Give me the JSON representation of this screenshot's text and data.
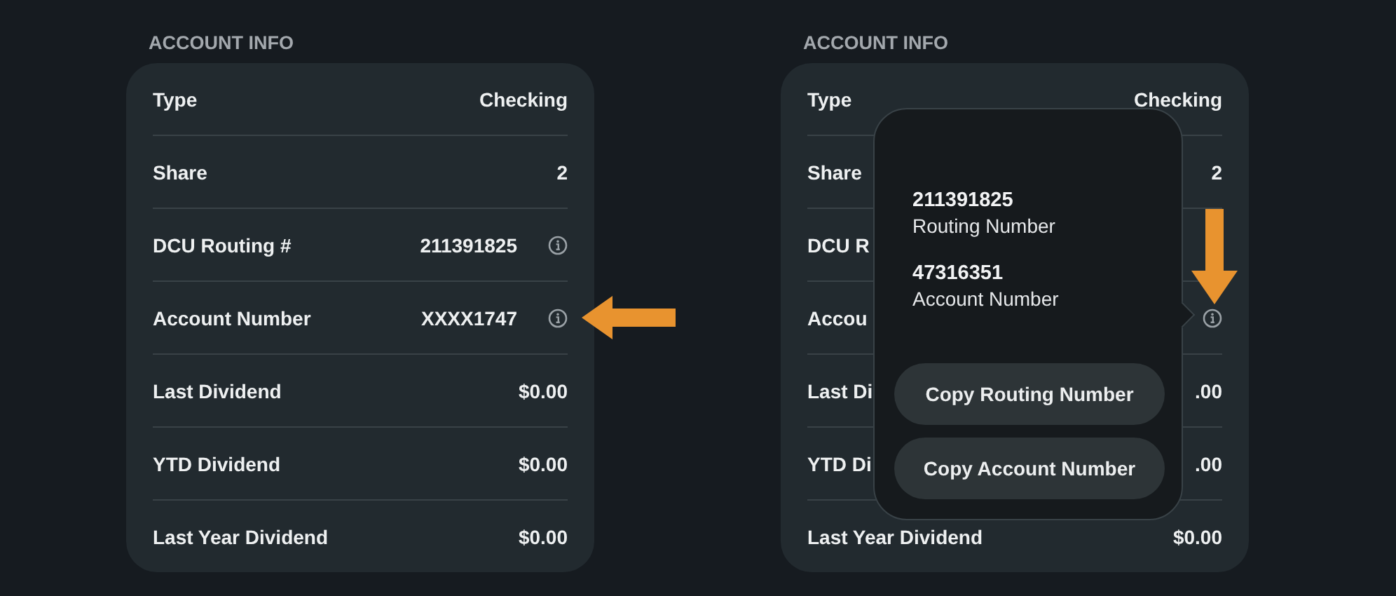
{
  "panels": [
    {
      "heading": "ACCOUNT INFO",
      "rows": [
        {
          "label": "Type",
          "value": "Checking",
          "info_icon": false
        },
        {
          "label": "Share",
          "value": "2",
          "info_icon": false
        },
        {
          "label": "DCU Routing #",
          "value": "211391825",
          "info_icon": true
        },
        {
          "label": "Account Number",
          "value": "XXXX1747",
          "info_icon": true,
          "annotation": {
            "kind": "arrow_left"
          }
        },
        {
          "label": "Last Dividend",
          "value": "$0.00",
          "info_icon": false
        },
        {
          "label": "YTD Dividend",
          "value": "$0.00",
          "info_icon": false
        },
        {
          "label": "Last Year Dividend",
          "value": "$0.00",
          "info_icon": false
        }
      ]
    },
    {
      "heading": "ACCOUNT INFO",
      "rows": [
        {
          "label": "Type",
          "value": "Checking",
          "info_icon": false
        },
        {
          "label": "Share",
          "value": "2",
          "info_icon": false
        },
        {
          "label": "DCU R",
          "info_icon": false
        },
        {
          "label": "Accou",
          "info_icon": true,
          "annotation": {
            "kind": "arrow_down"
          }
        },
        {
          "label": "Last Di",
          "value": ".00",
          "info_icon": false
        },
        {
          "label": "YTD Di",
          "value": ".00",
          "info_icon": false
        },
        {
          "label": "Last Year Dividend",
          "value": "$0.00",
          "info_icon": false
        }
      ],
      "popover": {
        "items": [
          {
            "number": "211391825",
            "caption": "Routing Number"
          },
          {
            "number": "47316351",
            "caption": "Account Number"
          }
        ],
        "buttons": [
          "Copy Routing Number",
          "Copy Account Number"
        ]
      }
    }
  ]
}
